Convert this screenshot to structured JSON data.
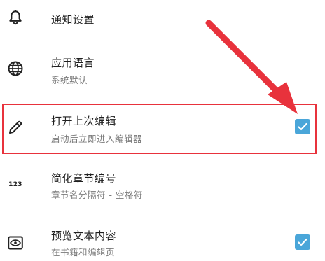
{
  "colors": {
    "accent": "#4aa6d9",
    "annotation": "#e8323c",
    "text_primary": "#1f1f1f",
    "text_secondary": "#7a7a7a"
  },
  "settings": [
    {
      "id": "notification",
      "icon": "bell-icon",
      "title": "通知设置",
      "subtitle": ""
    },
    {
      "id": "language",
      "icon": "globe-icon",
      "title": "应用语言",
      "subtitle": "系统默认"
    },
    {
      "id": "open-last-editor",
      "icon": "pencil-icon",
      "title": "打开上次编辑",
      "subtitle": "启动后立即进入编辑器",
      "checked": true
    },
    {
      "id": "simplify-chapter-number",
      "icon": "numbers-123-icon",
      "icon_text": "123",
      "title": "简化章节编号",
      "subtitle": "章节名分隔符 - 空格符"
    },
    {
      "id": "preview-text",
      "icon": "eye-icon",
      "title": "预览文本内容",
      "subtitle": "在书籍和编辑页",
      "checked": true
    }
  ]
}
